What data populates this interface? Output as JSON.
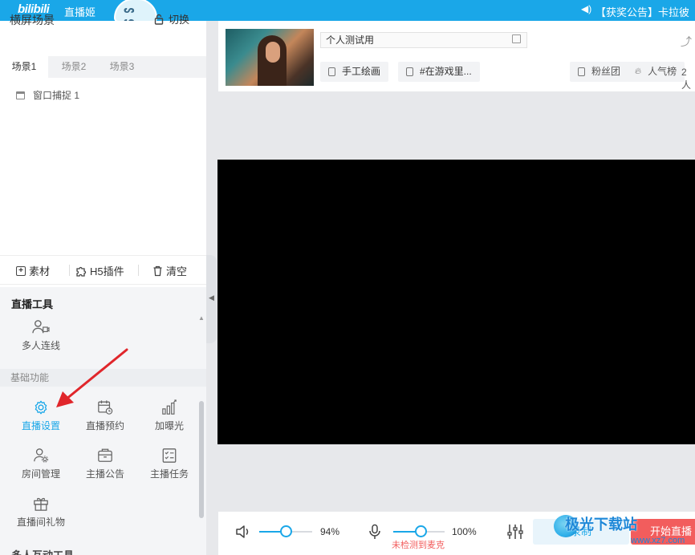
{
  "topbar": {
    "logo": "bilibili",
    "app_name": "直播姬",
    "announcement": "【获奖公告】卡拉彼"
  },
  "scene_panel": {
    "title": "横屏场景",
    "switch_label": "切换",
    "tabs": [
      {
        "label": "场景1",
        "active": true
      },
      {
        "label": "场景2",
        "active": false
      },
      {
        "label": "场景3",
        "active": false
      }
    ],
    "sources": [
      {
        "label": "窗口捕捉 1"
      }
    ],
    "toolbar": {
      "material": "素材",
      "h5_plugin": "H5插件",
      "clear": "清空"
    }
  },
  "tools_panel": {
    "title": "直播工具",
    "multi_link": "多人连线",
    "basic_section": "基础功能",
    "basic_items": [
      {
        "label": "直播设置",
        "icon": "gear-icon",
        "active": true
      },
      {
        "label": "直播预约",
        "icon": "calendar-clock-icon",
        "active": false
      },
      {
        "label": "加曝光",
        "icon": "bar-chart-up-icon",
        "active": false
      },
      {
        "label": "房间管理",
        "icon": "user-gear-icon",
        "active": false
      },
      {
        "label": "主播公告",
        "icon": "announcement-icon",
        "active": false
      },
      {
        "label": "主播任务",
        "icon": "task-list-icon",
        "active": false
      },
      {
        "label": "直播间礼物",
        "icon": "gift-icon",
        "active": false
      }
    ],
    "more_section": "多人互动工具"
  },
  "room": {
    "title": "个人测试用",
    "category": "手工绘画",
    "tag": "#在游戏里...",
    "fan_club": "粉丝团",
    "popularity": "人气榜",
    "viewers": "2人"
  },
  "bottom": {
    "speaker_volume": "94%",
    "speaker_level": 0.94,
    "mic_volume": "100%",
    "mic_level": 1.0,
    "mic_warning": "未检测到麦克",
    "record_label": "录制",
    "start_label": "开始直播"
  },
  "watermark": {
    "text": "极光下载站",
    "url": "www.xz7.com"
  },
  "colors": {
    "accent": "#1aa7e8",
    "danger": "#f25d5d",
    "arrow": "#e0262b"
  }
}
